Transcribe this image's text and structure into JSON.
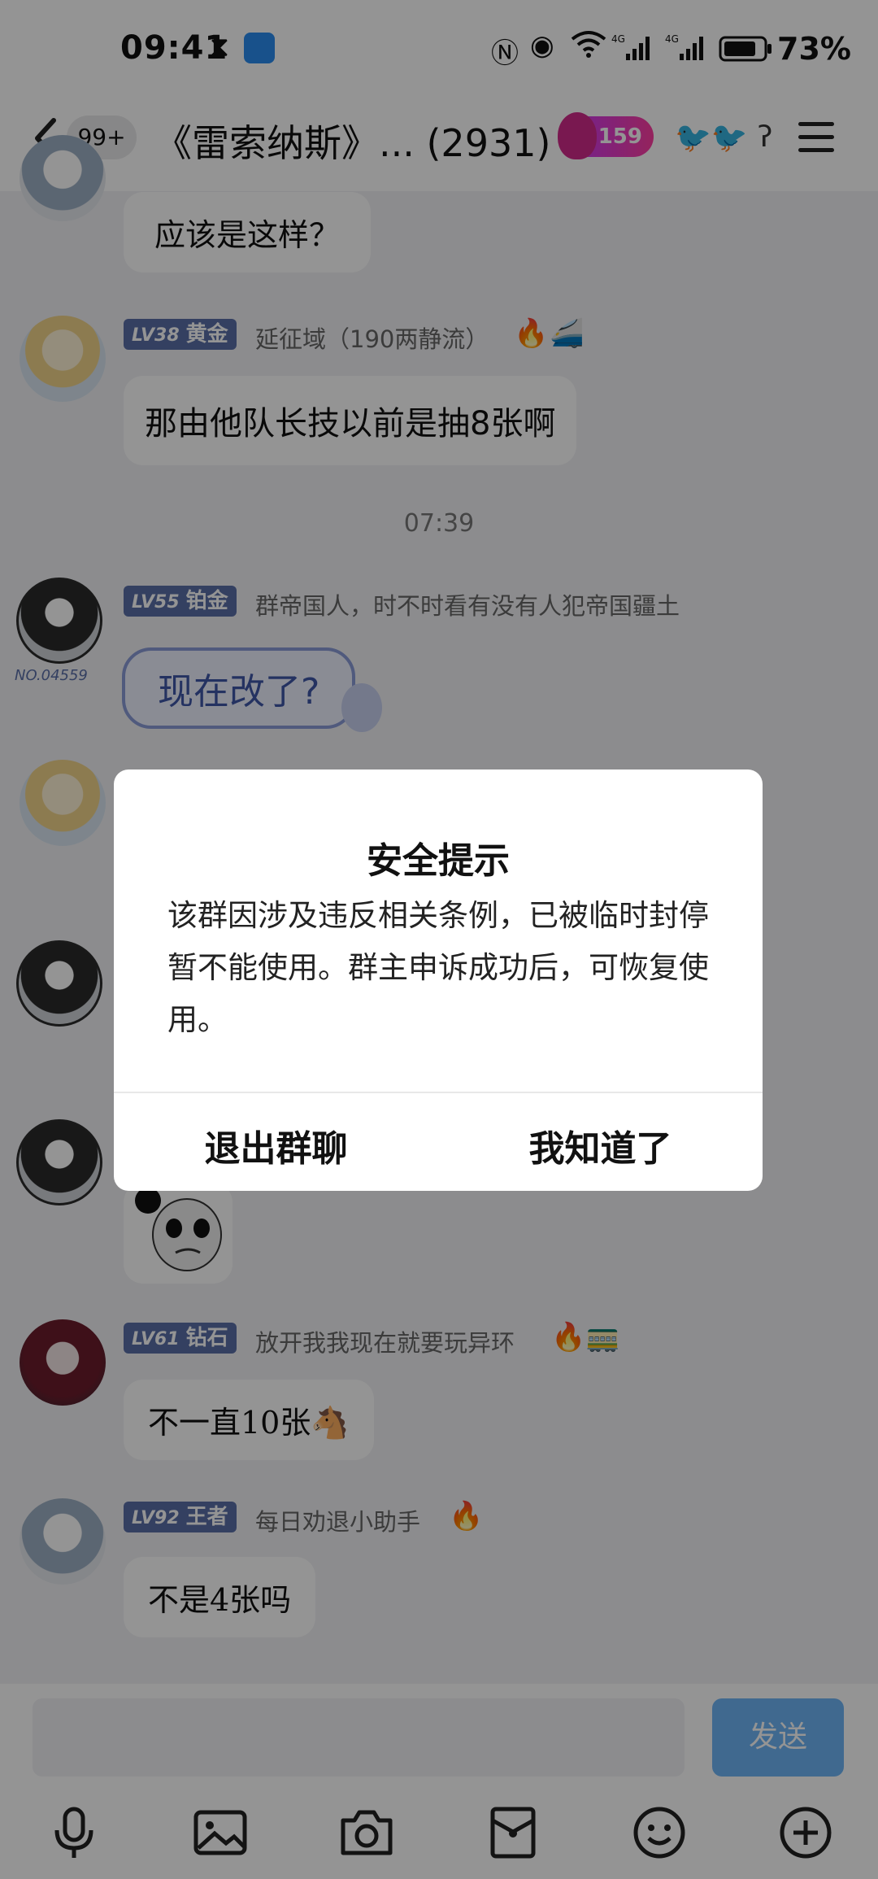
{
  "status_bar": {
    "time": "09:41",
    "battery_percent": "73%",
    "icons": [
      "hourglass-icon",
      "weather-icon",
      "nfc-icon",
      "eye-icon",
      "wifi-icon",
      "signal-4g-icon",
      "signal-4g-icon",
      "battery-icon"
    ]
  },
  "nav": {
    "unread_badge": "99+",
    "title": "《雷索纳斯》... (2931)",
    "fire_count": "159"
  },
  "chat": {
    "messages": [
      {
        "text": "应该是这样？"
      },
      {
        "level": "LV38",
        "rank": "黄金",
        "name": "延征域（190两静流）",
        "text": "那由他队长技以前是抽8张啊"
      },
      {
        "timestamp": "07:39"
      },
      {
        "level": "LV55",
        "rank": "铂金",
        "name": "群帝国人，时不时看有没有人犯帝国疆土",
        "text": "现在改了?"
      },
      {
        "level": "LV61",
        "rank": "钻石",
        "name": "放开我我现在就要玩异环",
        "text": "不一直10张🐴"
      },
      {
        "level": "LV92",
        "rank": "王者",
        "name": "每日劝退小助手",
        "text": "不是4张吗"
      }
    ],
    "avatar_tag": "NO.04559"
  },
  "input": {
    "placeholder": "",
    "send_label": "发送"
  },
  "dialog": {
    "title": "安全提示",
    "body": "该群因涉及违反相关条例，已被临时封停暂不能使用。群主申诉成功后，可恢复使用。",
    "left_button": "退出群聊",
    "right_button": "我知道了"
  },
  "colors": {
    "accent": "#6fb6f6",
    "level_tag": "#5a6ea8",
    "background": "#f1f2f5"
  }
}
